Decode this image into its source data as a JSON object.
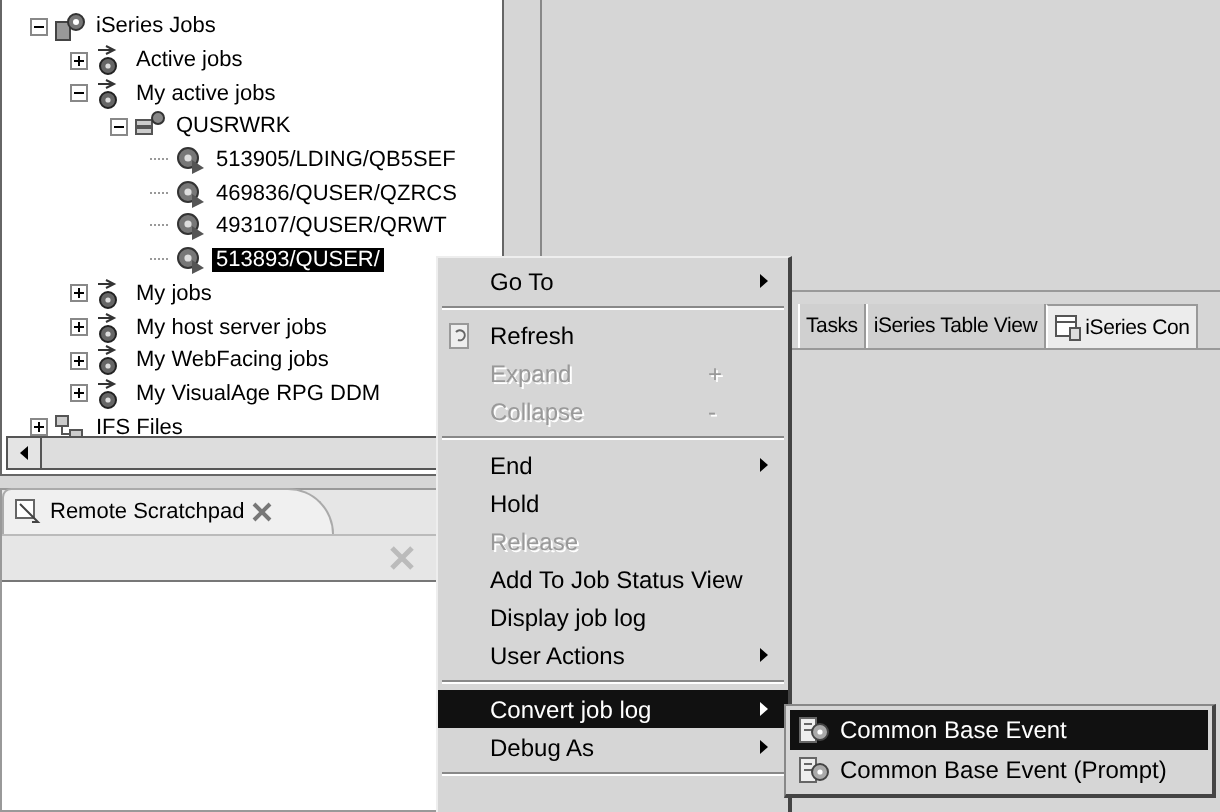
{
  "tree": [
    {
      "label": "iSeries Jobs",
      "kind": "jobs-folder",
      "expanded": true,
      "selected": false,
      "children": [
        {
          "label": "Active jobs",
          "kind": "filter",
          "expanded": false,
          "selected": false
        },
        {
          "label": "My active jobs",
          "kind": "filter",
          "expanded": true,
          "selected": false,
          "children": [
            {
              "label": "QUSRWRK",
              "kind": "subsystem",
              "expanded": true,
              "selected": false,
              "children": [
                {
                  "label": "513905/LDING/QB5SEF",
                  "kind": "job",
                  "selected": false
                },
                {
                  "label": "469836/QUSER/QZRCS",
                  "kind": "job",
                  "selected": false
                },
                {
                  "label": "493107/QUSER/QRWT",
                  "kind": "job",
                  "selected": false
                },
                {
                  "label": "513893/QUSER/",
                  "kind": "job",
                  "selected": true
                }
              ]
            }
          ]
        },
        {
          "label": "My jobs",
          "kind": "filter",
          "expanded": false,
          "selected": false
        },
        {
          "label": "My host server jobs",
          "kind": "filter",
          "expanded": false,
          "selected": false
        },
        {
          "label": "My WebFacing jobs",
          "kind": "filter",
          "expanded": false,
          "selected": false
        },
        {
          "label": "My VisualAge RPG DDM",
          "kind": "filter",
          "expanded": false,
          "selected": false
        }
      ]
    },
    {
      "label": "IFS Files",
      "kind": "ifs",
      "expanded": false,
      "selected": false
    }
  ],
  "scratchpad": {
    "tab": "Remote Scratchpad"
  },
  "tabs": [
    {
      "label": "Tasks",
      "selected": false
    },
    {
      "label": "iSeries Table View",
      "selected": false
    },
    {
      "label": "iSeries Con",
      "selected": true
    }
  ],
  "context_menu": [
    {
      "kind": "item",
      "label": "Go To",
      "submenu": true,
      "disabled": false,
      "selected": false
    },
    {
      "kind": "separator"
    },
    {
      "kind": "item",
      "label": "Refresh",
      "icon": true,
      "submenu": false,
      "disabled": false,
      "selected": false
    },
    {
      "kind": "item",
      "label": "Expand",
      "shortcut": "+",
      "submenu": false,
      "disabled": true,
      "selected": false
    },
    {
      "kind": "item",
      "label": "Collapse",
      "shortcut": "-",
      "submenu": false,
      "disabled": true,
      "selected": false
    },
    {
      "kind": "separator"
    },
    {
      "kind": "item",
      "label": "End",
      "submenu": true,
      "disabled": false,
      "selected": false
    },
    {
      "kind": "item",
      "label": "Hold",
      "submenu": false,
      "disabled": false,
      "selected": false
    },
    {
      "kind": "item",
      "label": "Release",
      "submenu": false,
      "disabled": true,
      "selected": false
    },
    {
      "kind": "item",
      "label": "Add To Job Status View",
      "submenu": false,
      "disabled": false,
      "selected": false
    },
    {
      "kind": "item",
      "label": "Display job log",
      "submenu": false,
      "disabled": false,
      "selected": false
    },
    {
      "kind": "item",
      "label": "User Actions",
      "submenu": true,
      "disabled": false,
      "selected": false
    },
    {
      "kind": "separator"
    },
    {
      "kind": "item",
      "label": "Convert job log",
      "submenu": true,
      "disabled": false,
      "selected": true
    },
    {
      "kind": "item",
      "label": "Debug As",
      "submenu": true,
      "disabled": false,
      "selected": false
    },
    {
      "kind": "separator"
    }
  ],
  "submenu": [
    {
      "label": "Common Base Event",
      "selected": true
    },
    {
      "label": "Common Base Event (Prompt)",
      "selected": false
    }
  ]
}
